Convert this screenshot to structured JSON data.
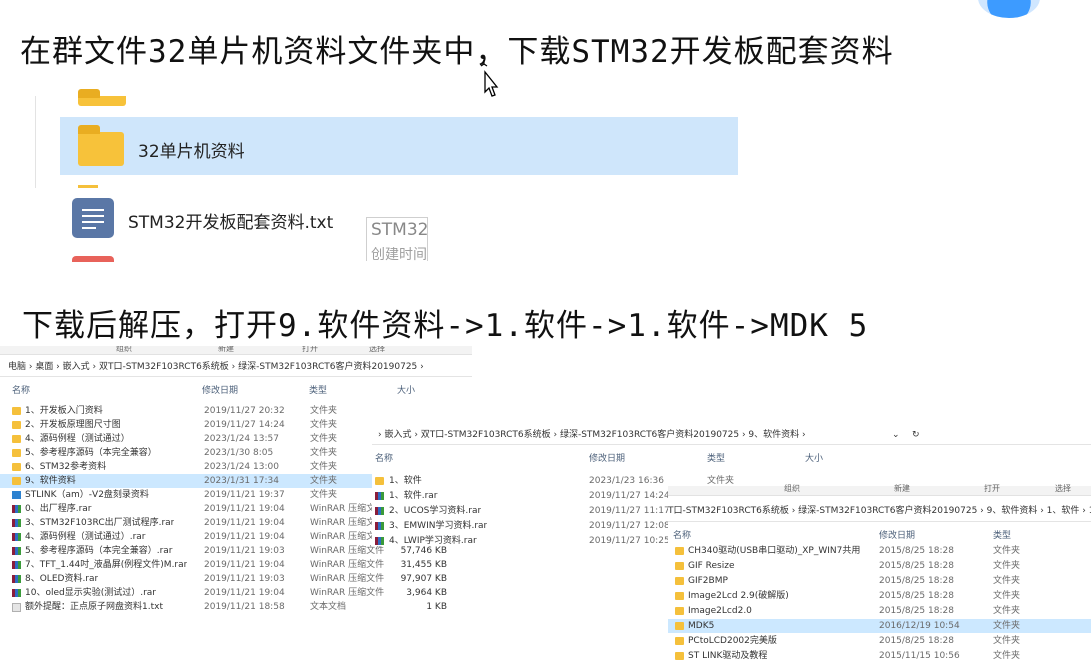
{
  "instruction1": "在群文件32单片机资料文件夹中，下载STM32开发板配套资料",
  "instruction2": "下载后解压，打开9.软件资料->1.软件->1.软件->MDK 5",
  "group_files": {
    "folder_name": "32单片机资料",
    "txt_name": "STM32开发板配套资料.txt",
    "tooltip_line1": "STM32",
    "tooltip_line2": "创建时间"
  },
  "explorer1": {
    "toolbar": [
      "组织",
      "新建",
      "打开",
      "选择"
    ],
    "breadcrumb": "电脑 › 桌面 › 嵌入式 › 双T口-STM32F103RCT6系统板 › 绿深-STM32F103RCT6客户资料20190725 ›",
    "columns": [
      "名称",
      "修改日期",
      "类型",
      "大小"
    ],
    "rows": [
      {
        "icon": "folder",
        "name": "1、开发板入门资料",
        "date": "2019/11/27 20:32",
        "type": "文件夹",
        "size": ""
      },
      {
        "icon": "folder",
        "name": "2、开发板原理图尺寸图",
        "date": "2019/11/27 14:24",
        "type": "文件夹",
        "size": ""
      },
      {
        "icon": "folder",
        "name": "4、源码例程（测试通过）",
        "date": "2023/1/24 13:57",
        "type": "文件夹",
        "size": ""
      },
      {
        "icon": "folder",
        "name": "5、参考程序源码（本完全兼容）",
        "date": "2023/1/30 8:05",
        "type": "文件夹",
        "size": ""
      },
      {
        "icon": "folder",
        "name": "6、STM32参考资料",
        "date": "2023/1/24 13:00",
        "type": "文件夹",
        "size": ""
      },
      {
        "icon": "folder",
        "name": "9、软件资料",
        "date": "2023/1/31 17:34",
        "type": "文件夹",
        "size": "",
        "selected": true
      },
      {
        "icon": "lnk",
        "name": "STLINK（am）-V2盘刻录资料",
        "date": "2019/11/21 19:37",
        "type": "文件夹",
        "size": ""
      },
      {
        "icon": "rar",
        "name": "0、出厂程序.rar",
        "date": "2019/11/21 19:04",
        "type": "WinRAR 压缩文件",
        "size": ""
      },
      {
        "icon": "rar",
        "name": "3、STM32F103RC出厂测试程序.rar",
        "date": "2019/11/21 19:04",
        "type": "WinRAR 压缩文件",
        "size": ""
      },
      {
        "icon": "rar",
        "name": "4、源码例程（测试通过）.rar",
        "date": "2019/11/21 19:04",
        "type": "WinRAR 压缩文件",
        "size": ""
      },
      {
        "icon": "rar",
        "name": "5、参考程序源码（本完全兼容）.rar",
        "date": "2019/11/21 19:03",
        "type": "WinRAR 压缩文件",
        "size": "57,746 KB"
      },
      {
        "icon": "rar",
        "name": "7、TFT_1.44吋_液晶屏(例程文件)M.rar",
        "date": "2019/11/21 19:04",
        "type": "WinRAR 压缩文件",
        "size": "31,455 KB"
      },
      {
        "icon": "rar",
        "name": "8、OLED资料.rar",
        "date": "2019/11/21 19:03",
        "type": "WinRAR 压缩文件",
        "size": "97,907 KB"
      },
      {
        "icon": "rar",
        "name": "10、oled显示实验(测试过）.rar",
        "date": "2019/11/21 19:04",
        "type": "WinRAR 压缩文件",
        "size": "3,964 KB"
      },
      {
        "icon": "txt",
        "name": "额外提醒：正点原子网盘资料1.txt",
        "date": "2019/11/21 18:58",
        "type": "文本文档",
        "size": "1 KB"
      }
    ]
  },
  "explorer2": {
    "breadcrumb": "› 嵌入式 › 双T口-STM32F103RCT6系统板 › 绿深-STM32F103RCT6客户资料20190725 › 9、软件资料 ›",
    "columns": [
      "名称",
      "修改日期",
      "类型",
      "大小"
    ],
    "rows": [
      {
        "icon": "folder",
        "name": "1、软件",
        "date": "2023/1/23 16:36",
        "type": "文件夹"
      },
      {
        "icon": "rar",
        "name": "1、软件.rar",
        "date": "2019/11/27 14:24",
        "type": ""
      },
      {
        "icon": "rar",
        "name": "2、UCOS学习资料.rar",
        "date": "2019/11/27 11:17",
        "type": ""
      },
      {
        "icon": "rar",
        "name": "3、EMWIN学习资料.rar",
        "date": "2019/11/27 12:08",
        "type": ""
      },
      {
        "icon": "rar",
        "name": "4、LWIP学习资料.rar",
        "date": "2019/11/27 10:25",
        "type": ""
      }
    ]
  },
  "explorer3": {
    "toolbar": [
      "组织",
      "新建",
      "打开",
      "选择"
    ],
    "breadcrumb": "T口-STM32F103RCT6系统板 › 绿深-STM32F103RCT6客户资料20190725 › 9、软件资料 › 1、软件 › 1、",
    "columns": [
      "名称",
      "修改日期",
      "类型"
    ],
    "rows": [
      {
        "icon": "folder",
        "name": "CH340驱动(USB串口驱动)_XP_WIN7共用",
        "date": "2015/8/25 18:28",
        "type": "文件夹"
      },
      {
        "icon": "folder",
        "name": "GIF Resize",
        "date": "2015/8/25 18:28",
        "type": "文件夹"
      },
      {
        "icon": "folder",
        "name": "GIF2BMP",
        "date": "2015/8/25 18:28",
        "type": "文件夹"
      },
      {
        "icon": "folder",
        "name": "Image2Lcd 2.9(破解版)",
        "date": "2015/8/25 18:28",
        "type": "文件夹"
      },
      {
        "icon": "folder",
        "name": "Image2Lcd2.0",
        "date": "2015/8/25 18:28",
        "type": "文件夹"
      },
      {
        "icon": "folder",
        "name": "MDK5",
        "date": "2016/12/19 10:54",
        "type": "文件夹",
        "selected": true
      },
      {
        "icon": "folder",
        "name": "PCtoLCD2002完美版",
        "date": "2015/8/25 18:28",
        "type": "文件夹"
      },
      {
        "icon": "folder",
        "name": "ST LINK驱动及教程",
        "date": "2015/11/15 10:56",
        "type": "文件夹"
      }
    ]
  }
}
